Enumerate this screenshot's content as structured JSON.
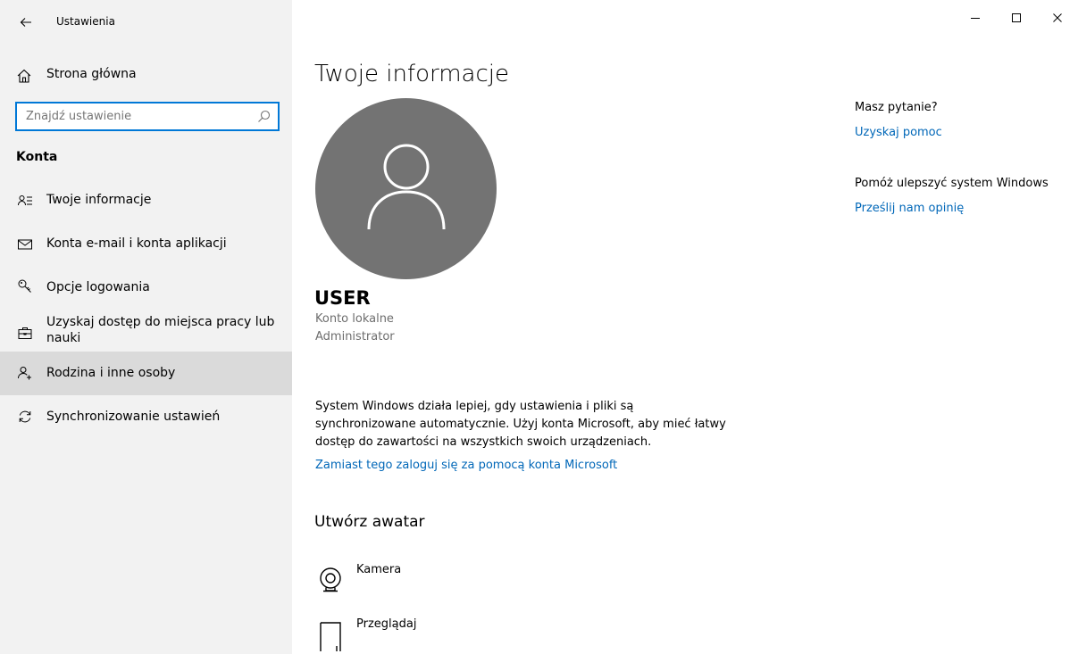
{
  "window": {
    "title": "Ustawienia",
    "controls": {
      "minimize": "minimize-icon",
      "maximize": "maximize-icon",
      "close": "close-icon"
    }
  },
  "sidebar": {
    "home_label": "Strona główna",
    "search": {
      "placeholder": "Znajdź ustawienie"
    },
    "section_title": "Konta",
    "items": [
      {
        "label": "Twoje informacje",
        "icon": "person-info-icon"
      },
      {
        "label": "Konta e-mail i konta aplikacji",
        "icon": "mail-icon"
      },
      {
        "label": "Opcje logowania",
        "icon": "key-icon"
      },
      {
        "label": "Uzyskaj dostęp do miejsca pracy lub nauki",
        "icon": "briefcase-icon"
      },
      {
        "label": "Rodzina i inne osoby",
        "icon": "person-add-icon",
        "selected": true
      },
      {
        "label": "Synchronizowanie ustawień",
        "icon": "sync-icon"
      }
    ]
  },
  "main": {
    "title": "Twoje informacje",
    "user": {
      "name": "USER",
      "account_type": "Konto lokalne",
      "role": "Administrator"
    },
    "description": "System Windows działa lepiej, gdy ustawienia i pliki są synchronizowane automatycznie. Użyj konta Microsoft, aby mieć łatwy dostęp do zawartości na wszystkich swoich urządzeniach.",
    "ms_link": "Zamiast tego zaloguj się za pomocą konta Microsoft",
    "avatar_section": {
      "title": "Utwórz awatar",
      "options": [
        {
          "label": "Kamera",
          "icon": "camera-icon"
        },
        {
          "label": "Przeglądaj",
          "icon": "browse-file-icon"
        }
      ]
    }
  },
  "aside": {
    "question": "Masz pytanie?",
    "help_link": "Uzyskaj pomoc",
    "improve": "Pomóż ulepszyć system Windows",
    "feedback_link": "Prześlij nam opinię"
  },
  "colors": {
    "accent": "#0078d7",
    "link": "#0067b8",
    "sidebar_bg": "#f2f2f2",
    "selected_bg": "#dadada",
    "avatar_bg": "#737373"
  }
}
